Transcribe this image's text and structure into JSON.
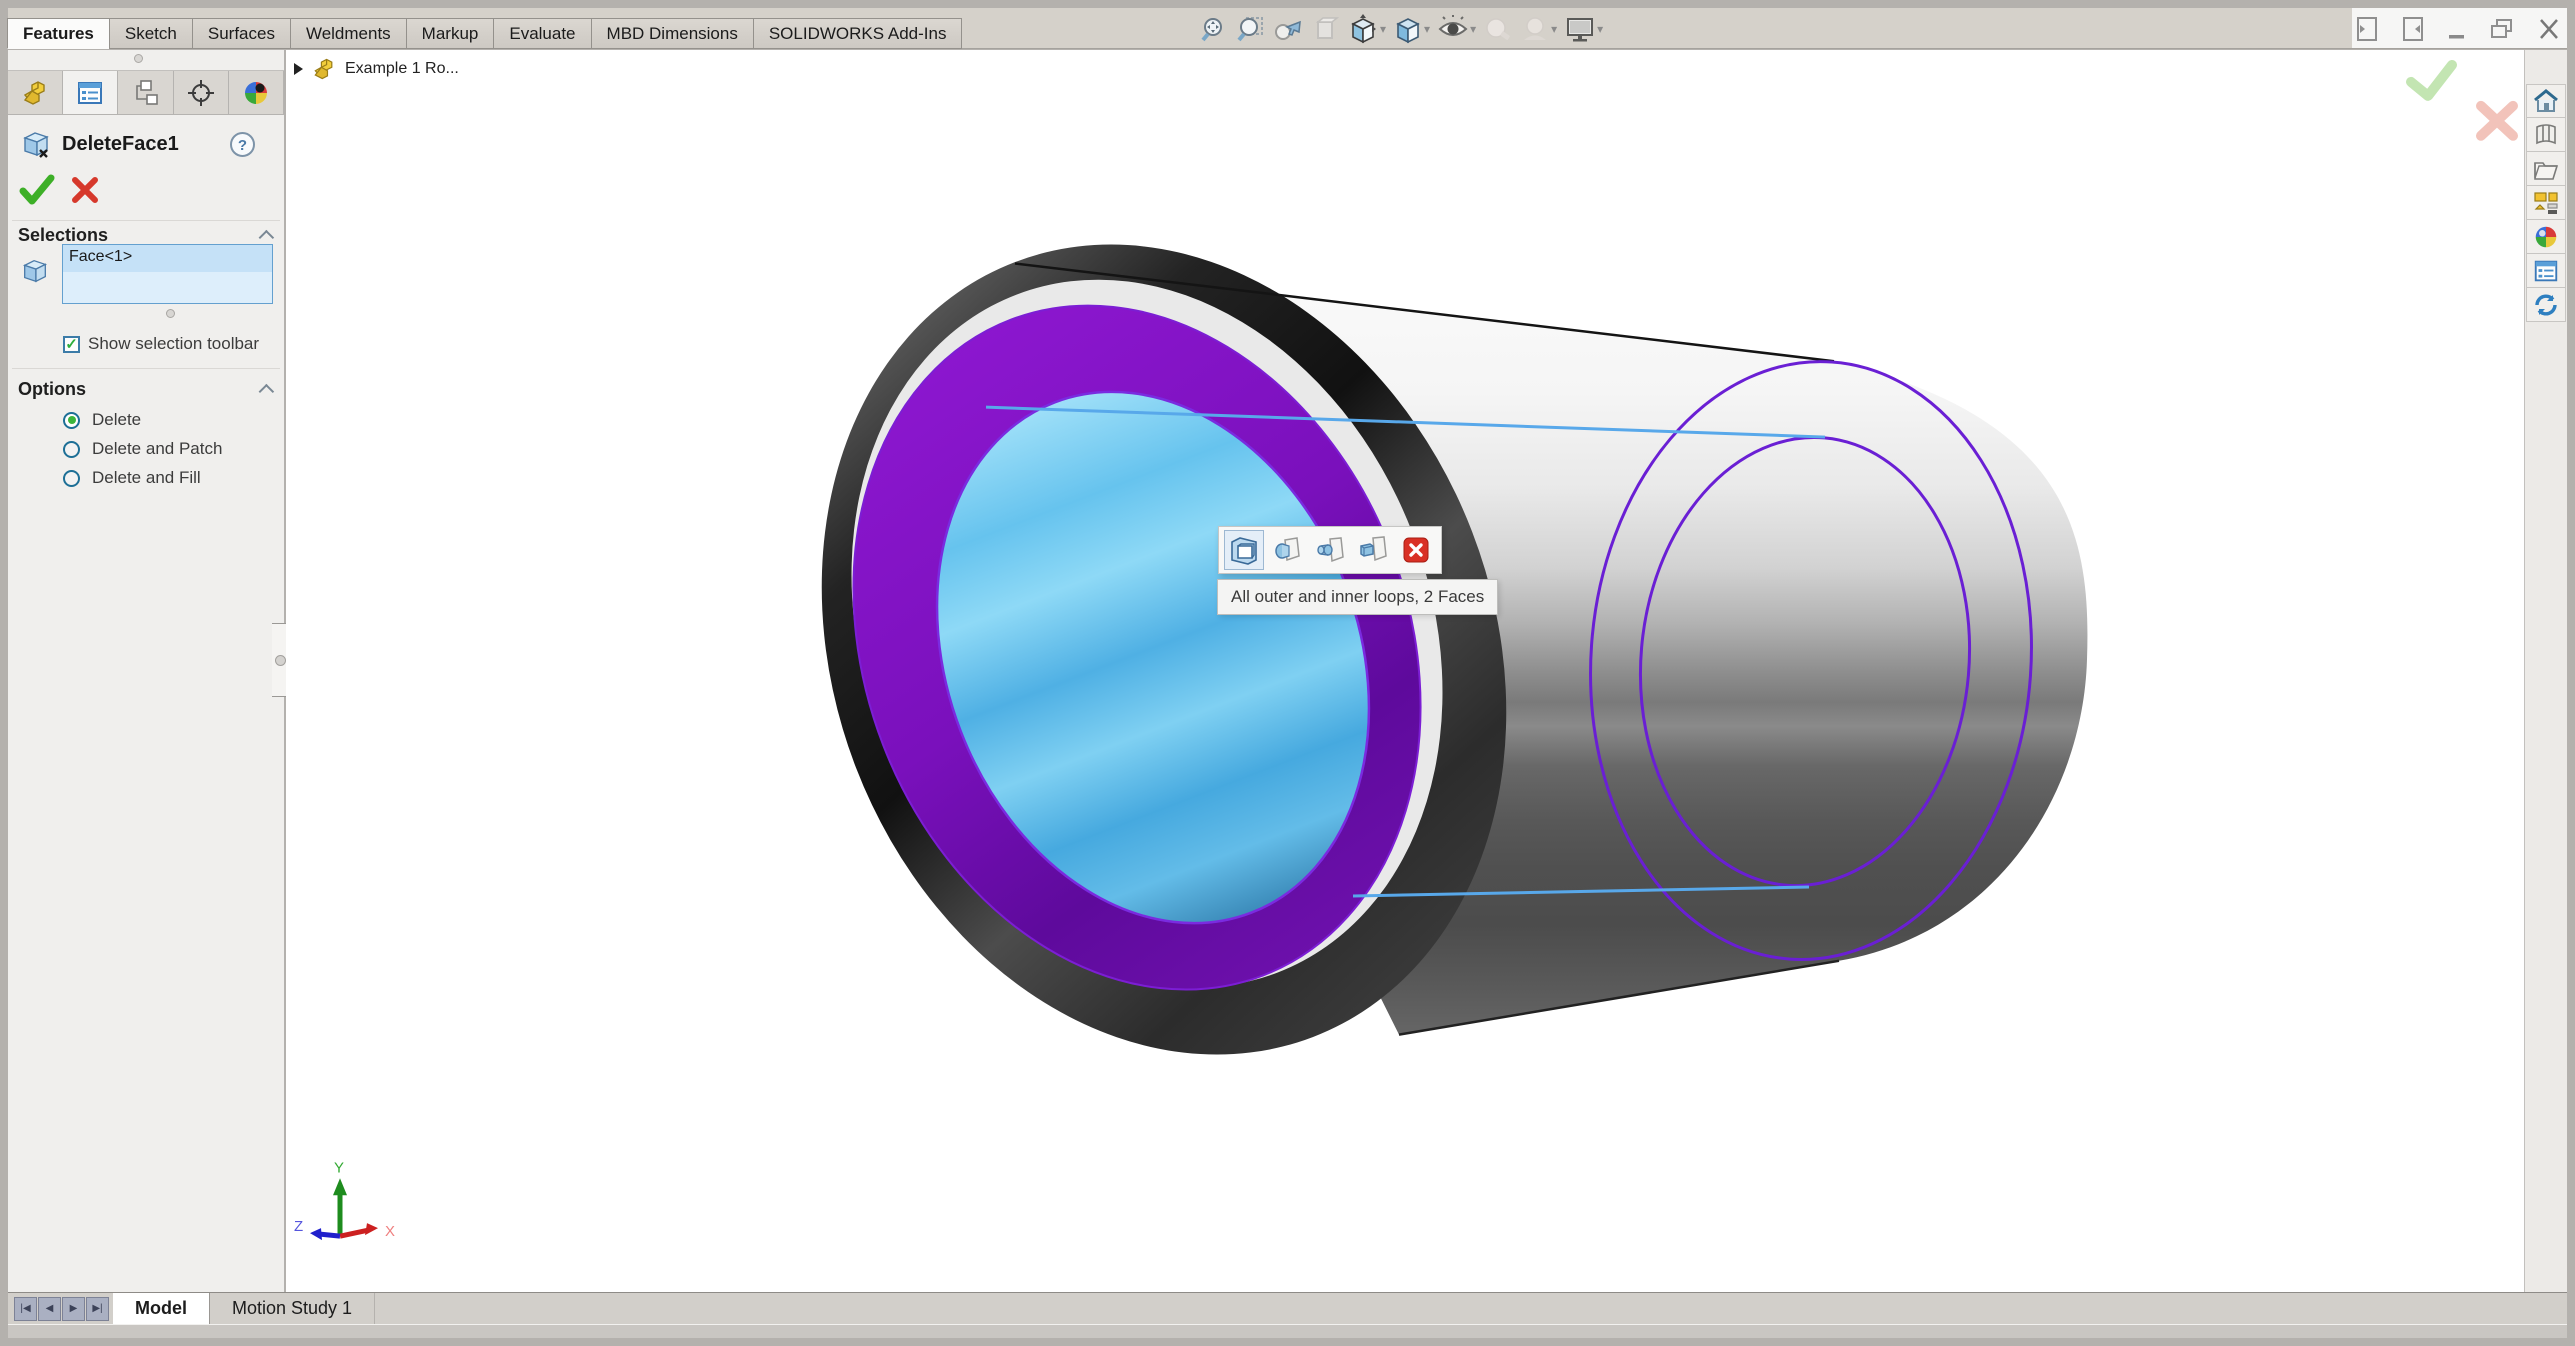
{
  "titlebar": {
    "tabs": [
      "Features",
      "Sketch",
      "Surfaces",
      "Weldments",
      "Markup",
      "Evaluate",
      "MBD Dimensions",
      "SOLIDWORKS Add-Ins"
    ],
    "active_tab": "Features",
    "tools": [
      "zoom-to-fit",
      "zoom-to-area",
      "previous-view",
      "section-view",
      "view-orientation",
      "display-style",
      "hide-show-items",
      "edit-appearance",
      "apply-scene",
      "view-settings"
    ]
  },
  "flyout_tree": {
    "part_name": "Example 1 Ro..."
  },
  "property_manager": {
    "title": "DeleteFace1",
    "help_glyph": "?",
    "tabs": [
      "featuremanager-design-tree",
      "propertymanager",
      "configuration-manager",
      "dimxpert-manager",
      "display-manager"
    ],
    "active_tab": "propertymanager",
    "selections": {
      "header": "Selections",
      "items": [
        "Face<1>"
      ],
      "checkbox_label": "Show selection toolbar",
      "checkbox_checked": true,
      "check_glyph": "✓"
    },
    "options": {
      "header": "Options",
      "choices": [
        "Delete",
        "Delete and Patch",
        "Delete and Fill"
      ],
      "selected": "Delete"
    }
  },
  "selection_popup": {
    "tooltip": "All outer and inner loops, 2 Faces",
    "buttons": [
      "all-outer-and-inner-loops",
      "select-tangent-faces",
      "select-boss-faces",
      "select-feature-faces",
      "close"
    ]
  },
  "task_pane": {
    "icons": [
      "solidworks-resources-home",
      "design-library",
      "file-explorer",
      "view-palette",
      "appearances-scenes",
      "custom-properties",
      "solidworks-forum"
    ]
  },
  "bottom_bar": {
    "sheet_tabs": [
      "Model",
      "Motion Study 1"
    ],
    "active": "Model"
  },
  "triad": {
    "x_label": "X",
    "y_label": "Y",
    "z_label": "Z"
  },
  "colors": {
    "selected_face_purple": "#7a10bc",
    "selected_face_cyan": "#5cb9ea",
    "highlight_edge_purple": "#6a1fd4",
    "highlight_edge_blue": "#58a8ea",
    "ok_green": "#3daf27",
    "cancel_red": "#d6382b"
  }
}
